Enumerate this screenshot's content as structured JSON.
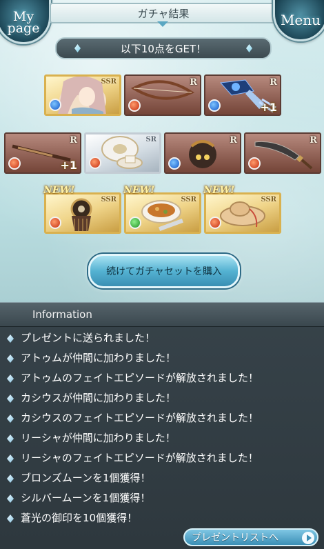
{
  "header": {
    "mypage_label_line1": "My",
    "mypage_label_line2": "page",
    "title": "ガチャ結果",
    "menu_label": "Menu"
  },
  "result_banner": "以下10点をGET！",
  "items": [
    {
      "rarity": "SSR",
      "element": "water",
      "kind": "character",
      "new": "",
      "plus": ""
    },
    {
      "rarity": "R",
      "element": "fire",
      "kind": "bow",
      "new": "",
      "plus": ""
    },
    {
      "rarity": "R",
      "element": "water",
      "kind": "gauntlet",
      "new": "",
      "plus": "+1"
    },
    {
      "rarity": "R",
      "element": "fire",
      "kind": "rifle",
      "new": "",
      "plus": "+1"
    },
    {
      "rarity": "SR",
      "element": "fire",
      "kind": "teacup",
      "new": "",
      "plus": ""
    },
    {
      "rarity": "R",
      "element": "water",
      "kind": "bomb",
      "new": "",
      "plus": ""
    },
    {
      "rarity": "R",
      "element": "fire",
      "kind": "scimitar",
      "new": "",
      "plus": ""
    },
    {
      "rarity": "SSR",
      "element": "fire",
      "kind": "ornament",
      "new": "NEW!",
      "plus": ""
    },
    {
      "rarity": "SSR",
      "element": "wind",
      "kind": "stew",
      "new": "NEW!",
      "plus": ""
    },
    {
      "rarity": "SSR",
      "element": "fire",
      "kind": "hat",
      "new": "NEW!",
      "plus": ""
    }
  ],
  "buy_button_label": "続けてガチャセットを購入",
  "information": {
    "heading": "Information",
    "lines": [
      "プレゼントに送られました！",
      "アトゥムが仲間に加わりました！",
      "アトゥムのフェイトエピソードが解放されました！",
      "カシウスが仲間に加わりました！",
      "カシウスのフェイトエピソードが解放されました！",
      "リーシャが仲間に加わりました！",
      "リーシャのフェイトエピソードが解放されました！",
      "ブロンズムーンを1個獲得！",
      "シルバームーンを1個獲得！",
      "蒼光の御印を10個獲得！"
    ]
  },
  "present_list_button_label": "プレゼントリストへ",
  "colors": {
    "fire": "#c32d10",
    "water": "#1356c8",
    "wind": "#1f8f24",
    "accent": "#3b8fb6"
  }
}
